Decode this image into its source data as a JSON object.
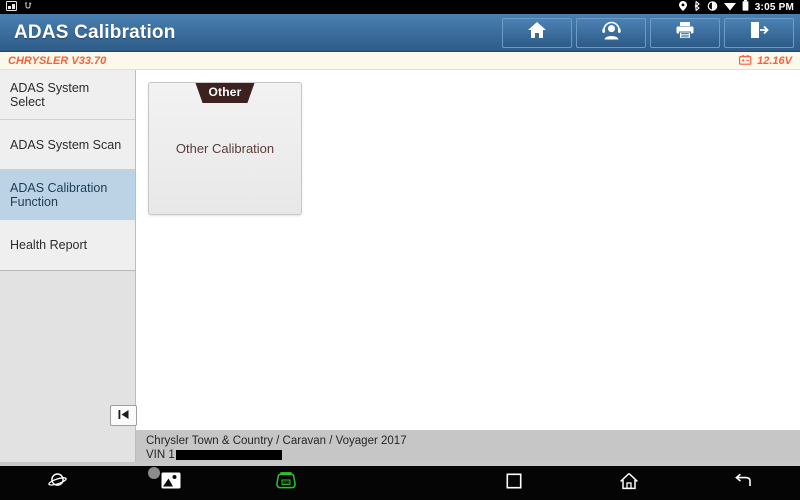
{
  "status_bar": {
    "left_icons": [
      "screenshot-icon",
      "usb-icon"
    ],
    "right_icons": [
      "location-icon",
      "bluetooth-icon",
      "sync-icon",
      "wifi-icon",
      "battery-icon"
    ],
    "time": "3:05 PM"
  },
  "header": {
    "title": "ADAS Calibration",
    "buttons": [
      {
        "name": "home-button",
        "icon": "home-icon"
      },
      {
        "name": "support-button",
        "icon": "headset-person-icon"
      },
      {
        "name": "print-button",
        "icon": "printer-icon"
      },
      {
        "name": "exit-button",
        "icon": "exit-door-icon"
      }
    ]
  },
  "version_bar": {
    "vehicle_version": "CHRYSLER V33.70",
    "voltage": "12.16V",
    "voltage_icon": "battery-icon",
    "accent_color": "#f2633c"
  },
  "sidebar": {
    "items": [
      {
        "label": "ADAS System Select",
        "selected": false
      },
      {
        "label": "ADAS System Scan",
        "selected": false
      },
      {
        "label": "ADAS Calibration Function",
        "selected": true
      },
      {
        "label": "Health Report",
        "selected": false
      }
    ],
    "selected_color": "#bcd3e6"
  },
  "main": {
    "cards": [
      {
        "ribbon": "Other",
        "label": "Other Calibration",
        "ribbon_color": "#3b2220",
        "label_color": "#5c3c3a"
      }
    ],
    "collapse_button_icon": "skip-to-start-icon"
  },
  "vehicle_info": {
    "model": "Chrysler Town & Country / Caravan / Voyager 2017",
    "vin_label": "VIN 1",
    "vin_value_redacted": true
  },
  "nav_bar": {
    "items": [
      {
        "name": "browser-button",
        "icon": "planet-icon"
      },
      {
        "name": "gallery-button",
        "icon": "image-icon"
      },
      {
        "name": "vci-button",
        "icon": "vci-icon",
        "color": "#2fc22f"
      },
      {
        "name": "recents-button",
        "icon": "square-icon"
      },
      {
        "name": "home-nav-button",
        "icon": "home-outline-icon"
      },
      {
        "name": "back-button",
        "icon": "back-arrow-icon"
      }
    ]
  }
}
